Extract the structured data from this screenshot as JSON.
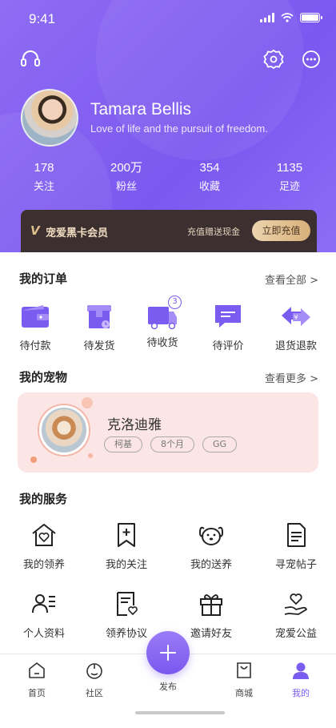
{
  "status_bar": {
    "time": "9:41"
  },
  "profile": {
    "name": "Tamara Bellis",
    "bio": "Love of life and the pursuit of freedom.",
    "stats": [
      {
        "value": "178",
        "label": "关注"
      },
      {
        "value": "200万",
        "label": "粉丝"
      },
      {
        "value": "354",
        "label": "收藏"
      },
      {
        "value": "1135",
        "label": "足迹"
      }
    ]
  },
  "vip": {
    "logo": "V",
    "title": "宠爱黑卡会员",
    "subtitle": "充值赠送现金",
    "button": "立即充值"
  },
  "orders": {
    "title": "我的订单",
    "more": "查看全部 >",
    "items": [
      {
        "label": "待付款",
        "icon": "wallet-icon"
      },
      {
        "label": "待发货",
        "icon": "package-icon"
      },
      {
        "label": "待收货",
        "icon": "delivery-truck-icon",
        "badge": "3"
      },
      {
        "label": "待评价",
        "icon": "comment-icon"
      },
      {
        "label": "退货退款",
        "icon": "refund-icon"
      }
    ]
  },
  "pets": {
    "title": "我的宠物",
    "more": "查看更多 >",
    "pet": {
      "name": "克洛迪雅",
      "tags": [
        "柯基",
        "8个月",
        "GG"
      ]
    }
  },
  "services": {
    "title": "我的服务",
    "items": [
      {
        "label": "我的领养",
        "icon": "house-heart-icon"
      },
      {
        "label": "我的关注",
        "icon": "bookmark-plus-icon"
      },
      {
        "label": "我的送养",
        "icon": "dog-face-icon"
      },
      {
        "label": "寻宠帖子",
        "icon": "document-icon"
      },
      {
        "label": "个人资料",
        "icon": "profile-card-icon"
      },
      {
        "label": "领养协议",
        "icon": "agreement-icon"
      },
      {
        "label": "邀请好友",
        "icon": "gift-icon"
      },
      {
        "label": "宠爱公益",
        "icon": "charity-hand-heart-icon"
      }
    ]
  },
  "tabbar": {
    "items": [
      {
        "label": "首页",
        "icon": "home-icon"
      },
      {
        "label": "社区",
        "icon": "community-icon"
      },
      {
        "label": "发布",
        "icon": "plus-icon"
      },
      {
        "label": "商城",
        "icon": "shopping-bag-icon"
      },
      {
        "label": "我的",
        "icon": "user-icon",
        "active": true
      }
    ]
  },
  "colors": {
    "accent": "#7b5cf0",
    "vip_bg": "#3b2f2f",
    "pet_card_bg": "#fbe5e5"
  }
}
